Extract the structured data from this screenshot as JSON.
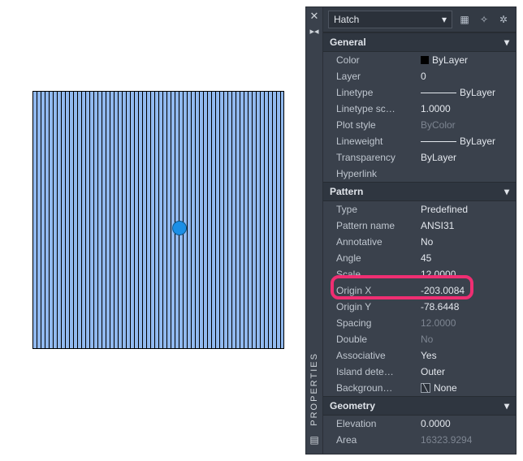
{
  "palette_title": "PROPERTIES",
  "object_type": "Hatch",
  "categories": {
    "general": {
      "title": "General",
      "color": "ByLayer",
      "layer": "0",
      "linetype": "ByLayer",
      "linetype_scale": "1.0000",
      "plot_style": "ByColor",
      "lineweight": "ByLayer",
      "transparency": "ByLayer",
      "hyperlink": ""
    },
    "pattern": {
      "title": "Pattern",
      "type": "Predefined",
      "pattern_name": "ANSI31",
      "annotative": "No",
      "angle": "45",
      "scale": "12.0000",
      "origin_x": "-203.0084",
      "origin_y": "-78.6448",
      "spacing": "12.0000",
      "double": "No",
      "associative": "Yes",
      "island_detection": "Outer",
      "background_color": "None"
    },
    "geometry": {
      "title": "Geometry",
      "elevation": "0.0000",
      "area": "16323.9294"
    }
  },
  "labels": {
    "color": "Color",
    "layer": "Layer",
    "linetype": "Linetype",
    "linetype_scale": "Linetype sc…",
    "plot_style": "Plot style",
    "lineweight": "Lineweight",
    "transparency": "Transparency",
    "hyperlink": "Hyperlink",
    "type": "Type",
    "pattern_name": "Pattern name",
    "annotative": "Annotative",
    "angle": "Angle",
    "scale": "Scale",
    "origin_x": "Origin X",
    "origin_y": "Origin Y",
    "spacing": "Spacing",
    "double": "Double",
    "associative": "Associative",
    "island_detection": "Island  dete…",
    "background_color": "Backgroun…",
    "elevation": "Elevation",
    "area": "Area"
  }
}
